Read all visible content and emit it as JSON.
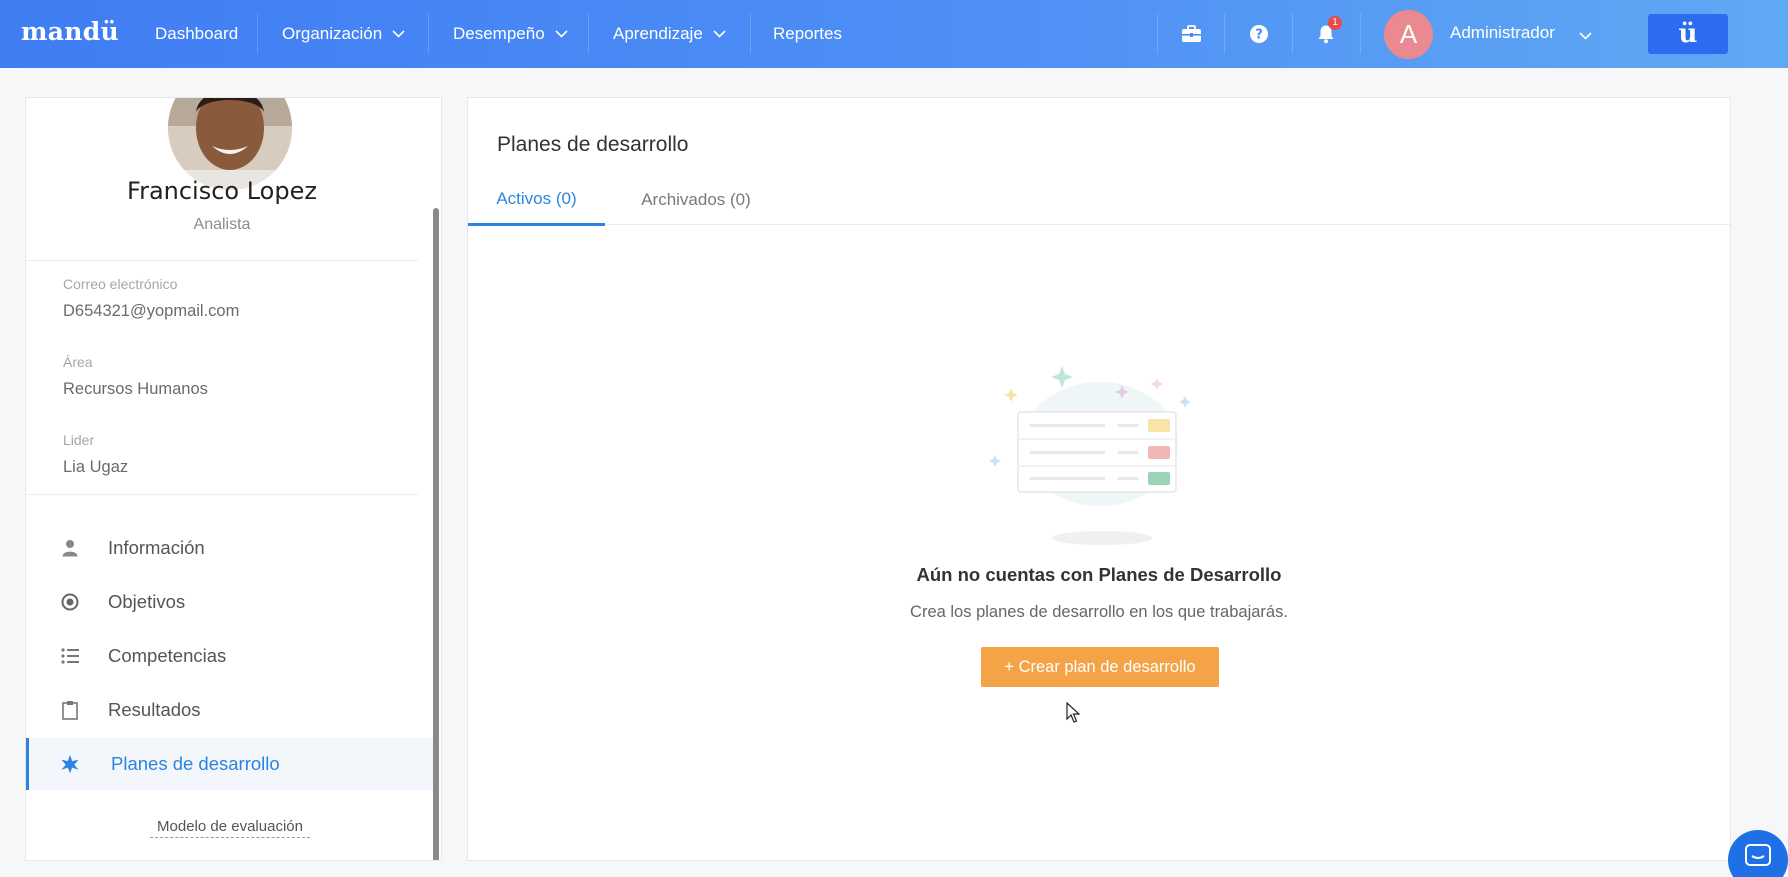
{
  "app": {
    "logo": "mandü",
    "brand_button": "ü"
  },
  "nav": {
    "items": [
      {
        "label": "Dashboard",
        "has_dropdown": false
      },
      {
        "label": "Organización",
        "has_dropdown": true
      },
      {
        "label": "Desempeño",
        "has_dropdown": true
      },
      {
        "label": "Aprendizaje",
        "has_dropdown": true
      },
      {
        "label": "Reportes",
        "has_dropdown": false
      }
    ],
    "notification_count": "1",
    "user": {
      "initial": "A",
      "name": "Administrador"
    },
    "icons": [
      "briefcase-icon",
      "help-icon",
      "bell-icon"
    ]
  },
  "profile": {
    "name": "Francisco Lopez",
    "role": "Analista",
    "fields": [
      {
        "label": "Correo electrónico",
        "value": "D654321@yopmail.com"
      },
      {
        "label": "Área",
        "value": "Recursos Humanos"
      },
      {
        "label": "Lider",
        "value": "Lia Ugaz"
      }
    ],
    "menu": [
      {
        "label": "Información",
        "icon": "person-icon",
        "active": false
      },
      {
        "label": "Objetivos",
        "icon": "target-icon",
        "active": false
      },
      {
        "label": "Competencias",
        "icon": "list-icon",
        "active": false
      },
      {
        "label": "Resultados",
        "icon": "clipboard-icon",
        "active": false
      },
      {
        "label": "Planes de desarrollo",
        "icon": "star-badge-icon",
        "active": true
      }
    ],
    "evaluation_link": "Modelo de evaluación"
  },
  "main": {
    "title": "Planes de desarrollo",
    "tabs": [
      {
        "label": "Activos (0)",
        "active": true
      },
      {
        "label": "Archivados (0)",
        "active": false
      }
    ],
    "empty_state": {
      "title": "Aún no cuentas con Planes de Desarrollo",
      "subtitle": "Crea los planes de desarrollo en los que trabajarás.",
      "button": "+ Crear plan de desarrollo"
    }
  },
  "colors": {
    "primary": "#2b85e0",
    "nav_gradient_start": "#3f7df3",
    "nav_gradient_end": "#5fa9f4",
    "cta": "#f5a347",
    "avatar": "#ea8a90"
  }
}
